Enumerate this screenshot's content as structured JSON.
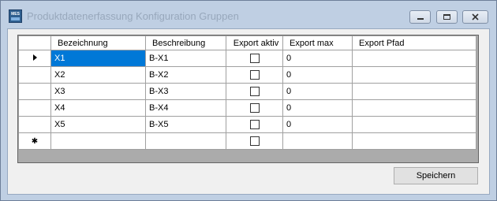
{
  "window": {
    "title": "Produktdatenerfassung Konfiguration Gruppen",
    "icon": "mes-app-icon",
    "icon_text": "MES"
  },
  "grid": {
    "columns": [
      "Bezeichnung",
      "Beschreibung",
      "Export aktiv",
      "Export max",
      "Export Pfad"
    ],
    "rows": [
      {
        "bezeichnung": "X1",
        "beschreibung": "B-X1",
        "export_aktiv": false,
        "export_max": "0",
        "export_pfad": ""
      },
      {
        "bezeichnung": "X2",
        "beschreibung": "B-X2",
        "export_aktiv": false,
        "export_max": "0",
        "export_pfad": ""
      },
      {
        "bezeichnung": "X3",
        "beschreibung": "B-X3",
        "export_aktiv": false,
        "export_max": "0",
        "export_pfad": ""
      },
      {
        "bezeichnung": "X4",
        "beschreibung": "B-X4",
        "export_aktiv": false,
        "export_max": "0",
        "export_pfad": ""
      },
      {
        "bezeichnung": "X5",
        "beschreibung": "B-X5",
        "export_aktiv": false,
        "export_max": "0",
        "export_pfad": ""
      }
    ],
    "current_row_indicator": "arrow-right-icon",
    "new_row_indicator": "asterisk-icon",
    "selection_color": "#0078d7"
  },
  "buttons": {
    "save_label": "Speichern"
  }
}
